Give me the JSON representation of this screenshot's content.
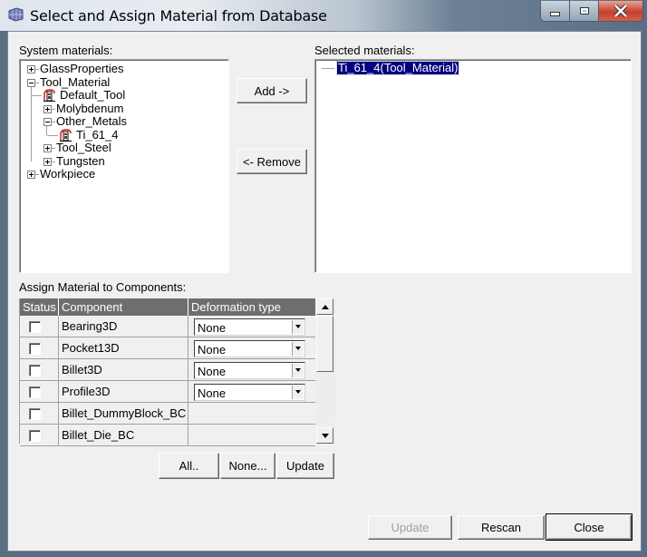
{
  "window": {
    "title": "Select and Assign Material from Database",
    "controls": {
      "minimize": "minimize-icon",
      "maximize": "maximize-icon",
      "close": "close-icon"
    }
  },
  "system_materials": {
    "label": "System materials:",
    "tree": [
      {
        "label": "GlassProperties",
        "level": 0,
        "expander": "plus"
      },
      {
        "label": "Tool_Material",
        "level": 0,
        "expander": "minus"
      },
      {
        "label": "Default_Tool",
        "level": 1,
        "expander": "none",
        "icon": "material-icon"
      },
      {
        "label": "Molybdenum",
        "level": 1,
        "expander": "plus"
      },
      {
        "label": "Other_Metals",
        "level": 1,
        "expander": "minus"
      },
      {
        "label": "Ti_61_4",
        "level": 2,
        "expander": "none",
        "icon": "material-icon"
      },
      {
        "label": "Tool_Steel",
        "level": 1,
        "expander": "plus"
      },
      {
        "label": "Tungsten",
        "level": 1,
        "expander": "plus"
      },
      {
        "label": "Workpiece",
        "level": 0,
        "expander": "plus"
      }
    ]
  },
  "selected_materials": {
    "label": "Selected materials:",
    "items": [
      {
        "label": "Ti_61_4(Tool_Material)",
        "selected": true
      }
    ]
  },
  "transfer_buttons": {
    "add": "Add ->",
    "remove": "<- Remove"
  },
  "assign": {
    "label": "Assign Material to Components:",
    "columns": [
      "Status",
      "Component",
      "Deformation type"
    ],
    "rows": [
      {
        "checked": false,
        "component": "Bearing3D",
        "deformation": "None"
      },
      {
        "checked": false,
        "component": "Pocket13D",
        "deformation": "None"
      },
      {
        "checked": false,
        "component": "Billet3D",
        "deformation": "None"
      },
      {
        "checked": false,
        "component": "Profile3D",
        "deformation": "None"
      },
      {
        "checked": false,
        "component": "Billet_DummyBlock_BC",
        "deformation": null
      },
      {
        "checked": false,
        "component": "Billet_Die_BC",
        "deformation": null
      }
    ],
    "buttons": {
      "all": "All..",
      "none": "None...",
      "update": "Update"
    }
  },
  "footer": {
    "update": "Update",
    "update_disabled": true,
    "rescan": "Rescan",
    "close": "Close"
  },
  "colors": {
    "selection_bg": "#000080",
    "selection_fg": "#ffffff",
    "header_bg": "#6e6e6e"
  }
}
